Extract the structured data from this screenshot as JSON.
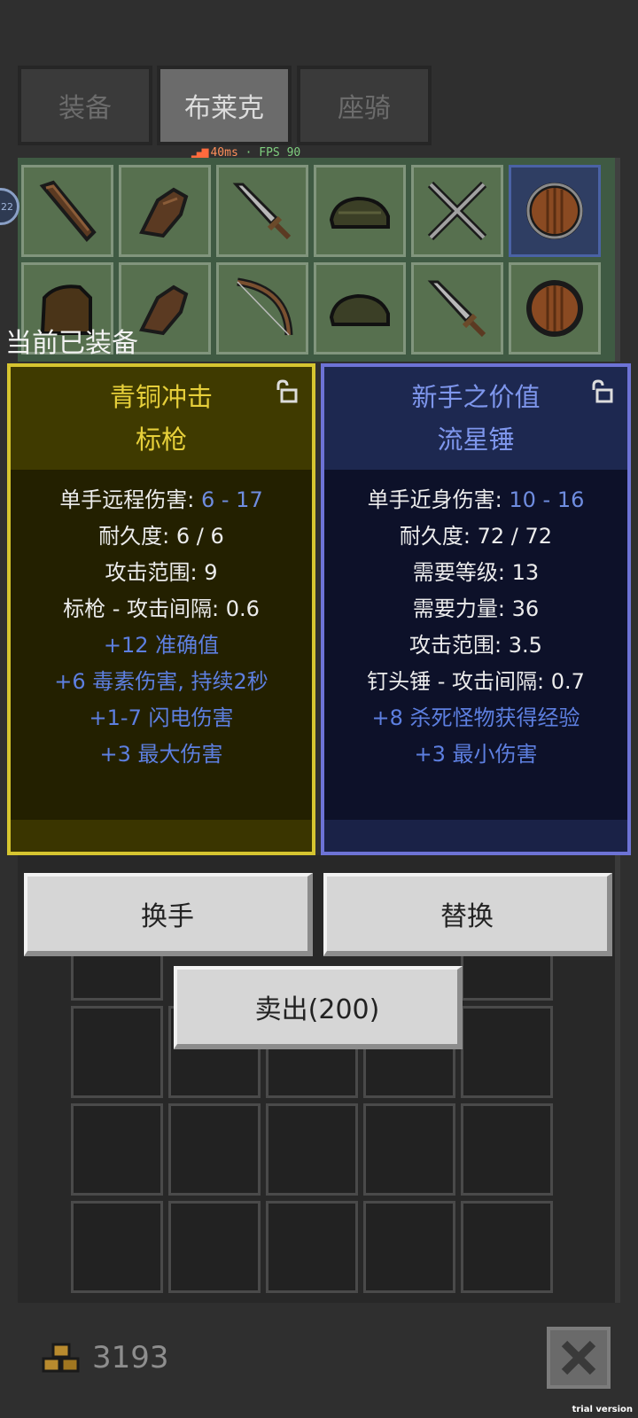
{
  "tabs": [
    {
      "label": "装备"
    },
    {
      "label": "布莱克"
    },
    {
      "label": "座骑"
    }
  ],
  "status": {
    "ping": "40ms",
    "fps": "FPS 90"
  },
  "avatar_badge": "22",
  "equipped_label": "当前已装备",
  "left_item": {
    "name_line1": "青铜冲击",
    "name_line2": "标枪",
    "stats": [
      {
        "label": "单手远程伤害: ",
        "value": "6 - 17"
      },
      {
        "label": "耐久度: 6 / 6"
      },
      {
        "label": "攻击范围: 9"
      },
      {
        "label": "标枪 - 攻击间隔: 0.6"
      }
    ],
    "affixes": [
      "+12 准确值",
      "+6 毒素伤害, 持续2秒",
      "+1-7 闪电伤害",
      "+3 最大伤害"
    ]
  },
  "right_item": {
    "name_line1": "新手之价值",
    "name_line2": "流星锤",
    "stats": [
      {
        "label": "单手近身伤害: ",
        "value": "10 - 16"
      },
      {
        "label": "耐久度: 72 / 72"
      },
      {
        "label": "需要等级: 13"
      },
      {
        "label": "需要力量: 36"
      },
      {
        "label": "攻击范围: 3.5"
      },
      {
        "label": "钉头锤 - 攻击间隔: 0.7"
      }
    ],
    "affixes": [
      "+8 杀死怪物获得经验",
      "+3 最小伤害"
    ]
  },
  "buttons": {
    "swap": "换手",
    "replace": "替换",
    "sell": "卖出(200)"
  },
  "gold": "3193",
  "watermark": "trial version",
  "colors": {
    "legendary_yellow": "#e6cf3a",
    "magic_blue": "#7e96ec"
  }
}
